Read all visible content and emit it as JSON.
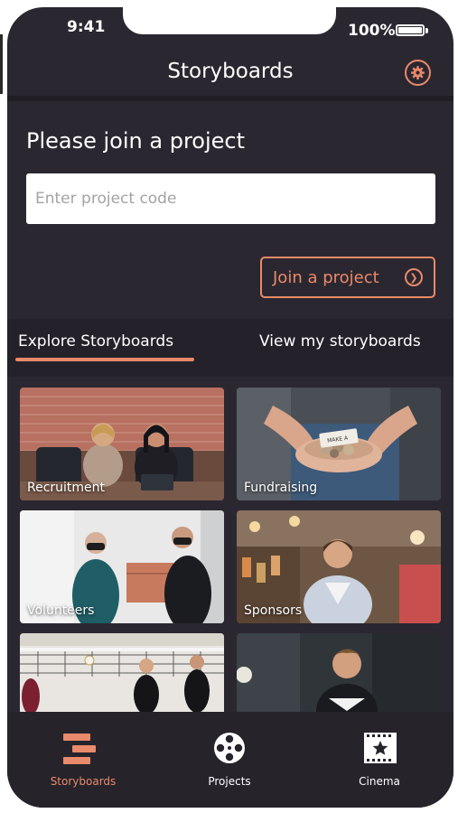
{
  "status_bar": {
    "time": "9:41",
    "battery": "100%"
  },
  "header": {
    "title": "Storyboards"
  },
  "join": {
    "heading": "Please join a project",
    "input_placeholder": "Enter project code",
    "button_label": "Join a project"
  },
  "tabs": [
    {
      "label": "Explore Storyboards",
      "active": true
    },
    {
      "label": "View my storyboards",
      "active": false
    }
  ],
  "cards": [
    {
      "label": "Recruitment"
    },
    {
      "label": "Fundraising"
    },
    {
      "label": "Volunteers"
    },
    {
      "label": "Sponsors"
    },
    {
      "label": ""
    },
    {
      "label": ""
    }
  ],
  "bottom_nav": [
    {
      "label": "Storyboards",
      "icon": "storyboards-icon",
      "active": true
    },
    {
      "label": "Projects",
      "icon": "film-reel-icon",
      "active": false
    },
    {
      "label": "Cinema",
      "icon": "ticket-star-icon",
      "active": false
    }
  ],
  "colors": {
    "accent": "#e98a6a",
    "background": "#2b2730",
    "text": "#ffffff"
  }
}
